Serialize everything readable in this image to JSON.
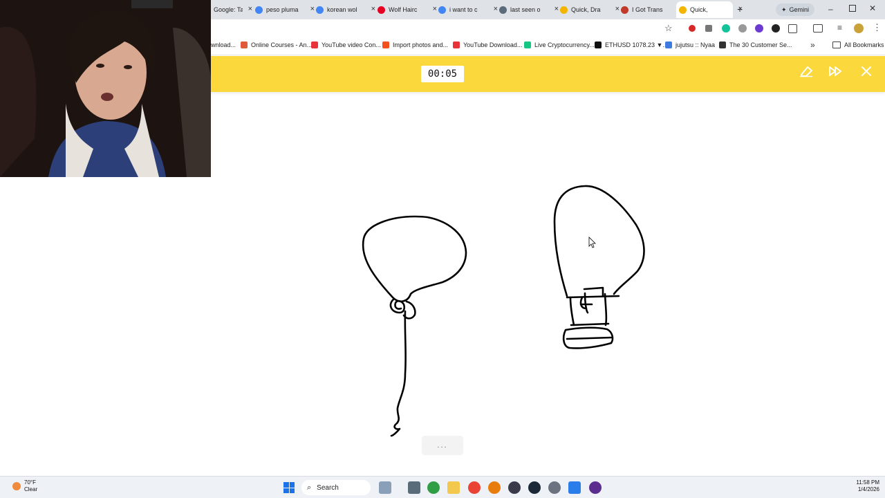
{
  "browser": {
    "tabs": [
      {
        "title": "Google: Ta",
        "color": "#34a853",
        "letter": "G"
      },
      {
        "title": "peso pluma",
        "color": "#4285f4",
        "letter": "G"
      },
      {
        "title": "korean wol",
        "color": "#4285f4",
        "letter": "G"
      },
      {
        "title": "Wolf Hairc",
        "color": "#e60023",
        "letter": "P"
      },
      {
        "title": "i want to c",
        "color": "#4285f4",
        "letter": "G"
      },
      {
        "title": "last seen o",
        "color": "#5a6b7a",
        "letter": "L"
      },
      {
        "title": "Quick, Dra",
        "color": "#f4b400",
        "letter": "Q"
      },
      {
        "title": "I Got Trans",
        "color": "#c0392b",
        "letter": "I"
      },
      {
        "title": "Quick,",
        "color": "#f4b400",
        "letter": "Q",
        "active": true
      }
    ],
    "new_tab": "+",
    "gemini": "Gemini",
    "bookmarks": [
      {
        "label": "wnload...",
        "color": "#4285f4"
      },
      {
        "label": "Online Courses - An...",
        "color": "#e05a3a"
      },
      {
        "label": "YouTube video Con...",
        "color": "#e8333a"
      },
      {
        "label": "Import photos and...",
        "color": "#f4511e"
      },
      {
        "label": "YouTube Download...",
        "color": "#e8333a"
      },
      {
        "label": "Live Cryptocurrency...",
        "color": "#16c784"
      },
      {
        "label": "ETHUSD 1078.23 ▼...",
        "color": "#111111"
      },
      {
        "label": "jujutsu :: Nyaa",
        "color": "#3d7be0"
      },
      {
        "label": "The 30 Customer Se...",
        "color": "#333333"
      }
    ],
    "more_bookmarks": "»",
    "all_bookmarks": "All Bookmarks"
  },
  "game": {
    "timer": "00:05",
    "accent": "#fbd83b",
    "buttons": {
      "clear": "eraser-icon",
      "skip": "skip-icon",
      "close": "close-icon"
    },
    "status_dots": "...",
    "drawings": [
      "balloon-drawing",
      "lightbulb-drawing"
    ]
  },
  "taskbar": {
    "weather_temp": "70°F",
    "weather_desc": "Clear",
    "search": "Search",
    "time": "11:58 PM",
    "date": "1/4/2026"
  }
}
